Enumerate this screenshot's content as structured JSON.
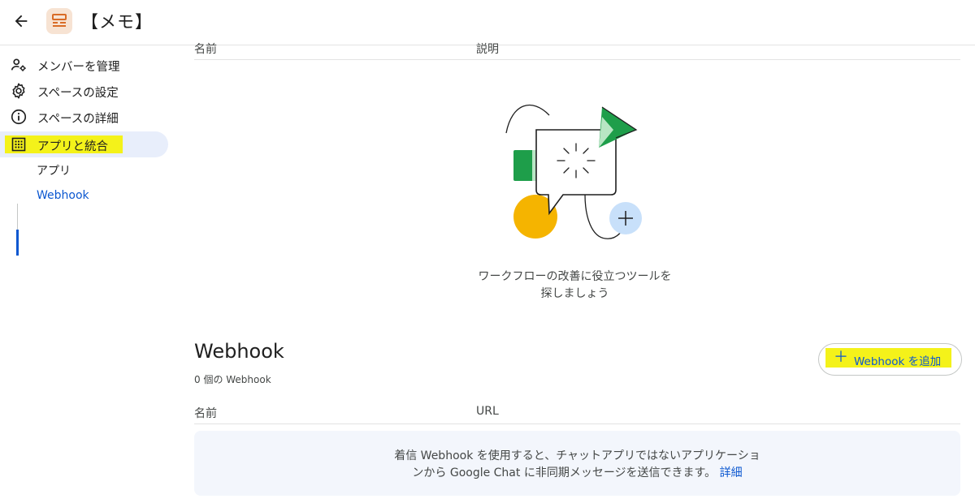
{
  "header": {
    "title": "【メモ】"
  },
  "sidebar": {
    "items": [
      {
        "label": "メンバーを管理",
        "icon": "manage-members-icon"
      },
      {
        "label": "スペースの設定",
        "icon": "gear-icon"
      },
      {
        "label": "スペースの詳細",
        "icon": "info-icon"
      },
      {
        "label": "アプリと統合",
        "icon": "apps-grid-icon"
      }
    ],
    "subitems": [
      {
        "label": "アプリ"
      },
      {
        "label": "Webhook"
      }
    ]
  },
  "apps_table": {
    "columns": [
      "名前",
      "説明"
    ],
    "empty_text_line1": "ワークフローの改善に役立つツールを",
    "empty_text_line2": "探しましょう"
  },
  "webhook": {
    "title": "Webhook",
    "count": "0 個の Webhook",
    "add_button": "Webhook を追加",
    "columns": [
      "名前",
      "URL"
    ],
    "info_line1": "着信 Webhook を使用すると、チャットアプリではないアプリケーショ",
    "info_line2": "ンから Google Chat に非同期メッセージを送信できます。",
    "info_link": "詳細"
  },
  "colors": {
    "accent": "#0b57d0",
    "highlight": "#f4f21a",
    "active_bg": "#e8eefb",
    "avatar_bg": "#f7e3d3",
    "avatar_fg": "#d96c27"
  }
}
